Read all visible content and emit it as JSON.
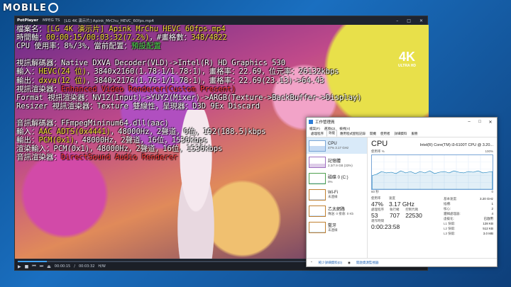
{
  "watermark": {
    "text": "MOBILE"
  },
  "player": {
    "brand": "PotPlayer",
    "tab": "MPEG TS",
    "file_title": "[LG 4K 演示片] Apink_MrChu_HEVC_60fps.mp4",
    "badge_4k": "4K",
    "badge_sub": "ULTRA HD",
    "osd": [
      {
        "parts": [
          {
            "c": "w",
            "t": "檔案名："
          },
          {
            "c": "y",
            "t": "[LG 4K 演示片] Apink MrChu HEVC 60fps.mp4"
          }
        ]
      },
      {
        "parts": [
          {
            "c": "w",
            "t": "時間軸："
          },
          {
            "c": "y",
            "t": "00:00:15/00:03:32(7.2%)"
          },
          {
            "c": "w",
            "t": "，#畫格數："
          },
          {
            "c": "y",
            "t": "348/4822"
          }
        ]
      },
      {
        "parts": [
          {
            "c": "w",
            "t": "CPU 使用率：8%/3%，當前配置："
          },
          {
            "c": "g",
            "t": "預設配置"
          }
        ]
      },
      {
        "parts": [
          {
            "c": "w",
            "t": " "
          }
        ]
      },
      {
        "parts": [
          {
            "c": "w",
            "t": "視訊解碼器：Native DXVA Decoder(VLD)->Intel(R) HD Graphics 530"
          }
        ]
      },
      {
        "parts": [
          {
            "c": "w",
            "t": "輸入："
          },
          {
            "c": "y",
            "t": "HEVC(24 位)"
          },
          {
            "c": "w",
            "t": "，3840x2160(1.78:1/1.78:1)，畫格率：22.69，位元率：26132kbps"
          }
        ]
      },
      {
        "parts": [
          {
            "c": "w",
            "t": "輸出："
          },
          {
            "c": "y",
            "t": "dxva(12 位)"
          },
          {
            "c": "w",
            "t": "，3840x2176(1.76:1/1.78:1)，畫格率：22.69(23.13)->64.43"
          }
        ]
      },
      {
        "parts": [
          {
            "c": "w",
            "t": "視訊渲染器："
          },
          {
            "c": "r",
            "t": "Enhanced Video Renderer(Custom Present)"
          }
        ]
      },
      {
        "parts": [
          {
            "c": "w",
            "t": "Format 視訊渲染器：NV12(Input)->YUY2(Mixer)->ARGB(Texture->BackBuffer->Display)"
          }
        ]
      },
      {
        "parts": [
          {
            "c": "w",
            "t": "Resizer 視訊渲染器：Texture 雙線性，呈現器：D3D 9Ex Discard"
          }
        ]
      },
      {
        "parts": [
          {
            "c": "w",
            "t": " "
          }
        ]
      },
      {
        "parts": [
          {
            "c": "w",
            "t": "音訊解碼器：FFmpegMininum64.dll(aac)"
          }
        ]
      },
      {
        "parts": [
          {
            "c": "w",
            "t": "輸入："
          },
          {
            "c": "y",
            "t": "AAC ADTS(0x4441)"
          },
          {
            "c": "w",
            "t": "，48000Hz，2聲道，0位，192(188.5)kbps"
          }
        ]
      },
      {
        "parts": [
          {
            "c": "w",
            "t": "輸出："
          },
          {
            "c": "y",
            "t": "PCM(0x1)"
          },
          {
            "c": "w",
            "t": "，48000Hz，2聲道，16位，1536kbps"
          }
        ]
      },
      {
        "parts": [
          {
            "c": "w",
            "t": "渲染輸入：PCM(0x1)，48000Hz，2聲道，16位，1536kbps"
          }
        ]
      },
      {
        "parts": [
          {
            "c": "w",
            "t": "音訊渲染器："
          },
          {
            "c": "r",
            "t": "DirectSound Audio Renderer"
          }
        ]
      }
    ],
    "time_current": "00:00:15",
    "time_total": "00:03:32",
    "codec_label": "H/W",
    "progress": 0.072
  },
  "taskmgr": {
    "title": "工作管理員",
    "menu": [
      "檔案(F)",
      "選項(O)",
      "檢視(V)"
    ],
    "tabs": [
      "處理程序",
      "效能",
      "應用程式歷程記錄",
      "開機",
      "使用者",
      "詳細資料",
      "服務"
    ],
    "active_tab": 1,
    "side": [
      {
        "name": "CPU",
        "sub": "47% 3.17 GHz",
        "kind": "cpu"
      },
      {
        "name": "記憶體",
        "sub": "2.3/7.9 GB (33%)",
        "kind": "mem"
      },
      {
        "name": "磁碟 0 (C:)",
        "sub": "0%",
        "kind": "disk"
      },
      {
        "name": "Wi-Fi",
        "sub": "未連線",
        "kind": "net"
      },
      {
        "name": "乙太網路",
        "sub": "傳送: 0 接收: 0 Kb",
        "kind": "net"
      },
      {
        "name": "藍牙",
        "sub": "未連線",
        "kind": "net"
      }
    ],
    "cpu_title": "CPU",
    "cpu_model": "Intel(R) Core(TM) i3-6100T CPU @ 3.20...",
    "util_label": "使用率 %",
    "util_max": "100%",
    "axis_left": "60 秒",
    "axis_right": "0",
    "stats": {
      "utilization_label": "使用率",
      "utilization": "47%",
      "speed_label": "速度",
      "speed": "3.17 GHz",
      "processes_label": "處理程序",
      "processes": "53",
      "threads_label": "執行緒",
      "threads": "707",
      "handles_label": "控制代碼",
      "handles": "22530",
      "uptime_label": "運作時間",
      "uptime": "0:00:23:58"
    },
    "details": [
      {
        "k": "基本速度:",
        "v": "3.20 GHz"
      },
      {
        "k": "插槽:",
        "v": "1"
      },
      {
        "k": "核心:",
        "v": "2"
      },
      {
        "k": "邏輯處理器:",
        "v": "4"
      },
      {
        "k": "虛擬化:",
        "v": "已啟用"
      },
      {
        "k": "L1 快取:",
        "v": "128 KB"
      },
      {
        "k": "L2 快取:",
        "v": "512 KB"
      },
      {
        "k": "L3 快取:",
        "v": "3.0 MB"
      }
    ],
    "footer_less": "較少詳細資料(D)",
    "footer_monitor": "開啟資源監視器"
  }
}
